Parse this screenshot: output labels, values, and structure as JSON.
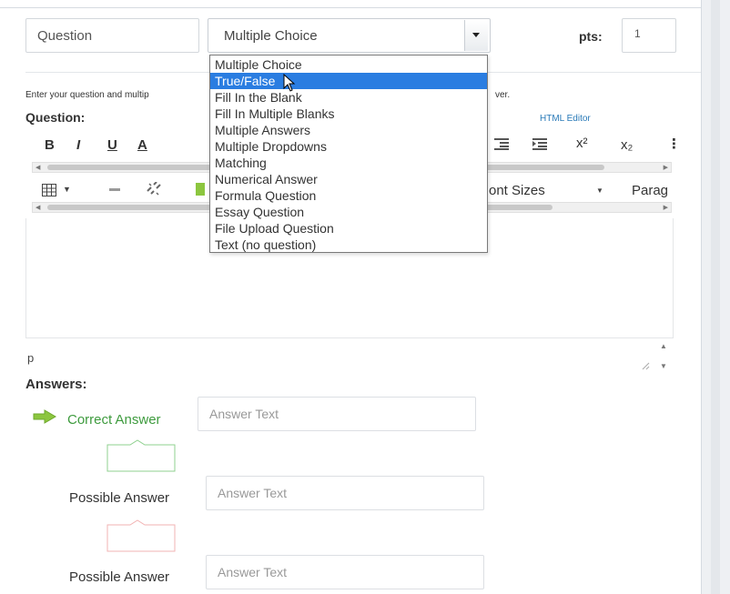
{
  "header": {
    "question_name_value": "Question",
    "question_type_value": "Multiple Choice",
    "pts_label": "pts:",
    "pts_value": "1"
  },
  "dropdown": {
    "options": [
      "Multiple Choice",
      "True/False",
      "Fill In the Blank",
      "Fill In Multiple Blanks",
      "Multiple Answers",
      "Multiple Dropdowns",
      "Matching",
      "Numerical Answer",
      "Formula Question",
      "Essay Question",
      "File Upload Question",
      "Text (no question)"
    ],
    "highlighted_index": 1
  },
  "instructions": {
    "text_start": "Enter your question and multip",
    "text_end": "ver."
  },
  "question": {
    "label": "Question:",
    "html_editor_link": "HTML Editor"
  },
  "toolbar": {
    "bold": "B",
    "italic": "I",
    "underline": "U",
    "font_color": "A",
    "superscript": "x²",
    "subscript": "x₂",
    "font_sizes": "ont Sizes",
    "paragraph": "Parag"
  },
  "editor": {
    "status_path": "p"
  },
  "answers": {
    "label": "Answers:",
    "correct_label": "Correct Answer",
    "possible_label": "Possible Answer",
    "placeholder": "Answer Text"
  },
  "colors": {
    "accent_blue": "#2a7de1",
    "correct_green": "#3e9b3e",
    "arrow_green": "#8cc63f",
    "link_blue": "#2a7ab8"
  }
}
